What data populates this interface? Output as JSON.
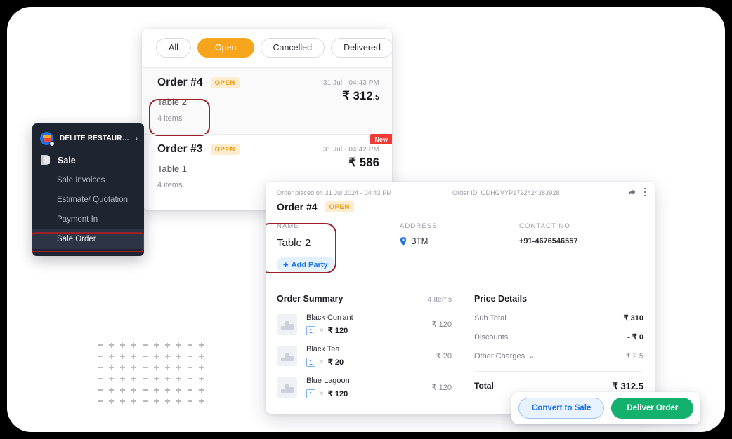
{
  "sidebar": {
    "brand": "DELITE RESTAUR…",
    "chevron": "›",
    "section": "Sale",
    "items": [
      {
        "label": "Sale Invoices"
      },
      {
        "label": "Estimate/ Quotation"
      },
      {
        "label": "Payment In"
      },
      {
        "label": "Sale Order"
      }
    ]
  },
  "orders_panel": {
    "filters": [
      {
        "label": "All",
        "active": false
      },
      {
        "label": "Open",
        "active": true
      },
      {
        "label": "Cancelled",
        "active": false
      },
      {
        "label": "Delivered",
        "active": false
      }
    ],
    "orders": [
      {
        "title": "Order #4",
        "status": "OPEN",
        "time": "31 Jul · 04:43 PM",
        "table": "Table 2",
        "items": "4 items",
        "amount_main": "₹ 312",
        "amount_dec": ".5",
        "new_badge": ""
      },
      {
        "title": "Order #3",
        "status": "OPEN",
        "time": "31 Jul · 04:42 PM",
        "table": "Table 1",
        "items": "4 items",
        "amount_main": "₹ 586",
        "amount_dec": "",
        "new_badge": "New"
      }
    ]
  },
  "detail": {
    "placed_on": "Order placed on 31 Jul 2024 - 04:43 PM",
    "order_id": "Order ID: ODHGVYP1722424383928",
    "title": "Order #4",
    "status": "OPEN",
    "name_label": "NAME",
    "name_value": "Table 2",
    "add_party": "Add Party",
    "add_party_plus": "+",
    "address_label": "ADDRESS",
    "address_value": "BTM",
    "contact_label": "CONTACT NO",
    "contact_value": "+91-4676546557",
    "summary_title": "Order Summary",
    "summary_count": "4 Items",
    "items": [
      {
        "name": "Black Currant",
        "qty": "1",
        "times": "×",
        "unit": "₹ 120",
        "total": "₹ 120"
      },
      {
        "name": "Black Tea",
        "qty": "1",
        "times": "×",
        "unit": "₹ 20",
        "total": "₹ 20"
      },
      {
        "name": "Blue Lagoon",
        "qty": "1",
        "times": "×",
        "unit": "₹ 120",
        "total": "₹ 120"
      }
    ],
    "price_title": "Price Details",
    "price_rows": [
      {
        "label": "Sub Total",
        "value": "₹ 310"
      },
      {
        "label": "Discounts",
        "value": "- ₹ 0"
      },
      {
        "label": "Other Charges",
        "value": "₹ 2.5",
        "caret": "⌄"
      }
    ],
    "total_label": "Total",
    "total_value": "₹ 312.5"
  },
  "actions": {
    "convert": "Convert to Sale",
    "deliver": "Deliver Order"
  },
  "colors": {
    "accent_orange": "#f7a51c",
    "accent_blue": "#1f73e8",
    "accent_green": "#13b06e",
    "badge_red": "#ef3b33",
    "annotation_red": "#9e1f25",
    "sidebar_bg": "#1e2430"
  }
}
